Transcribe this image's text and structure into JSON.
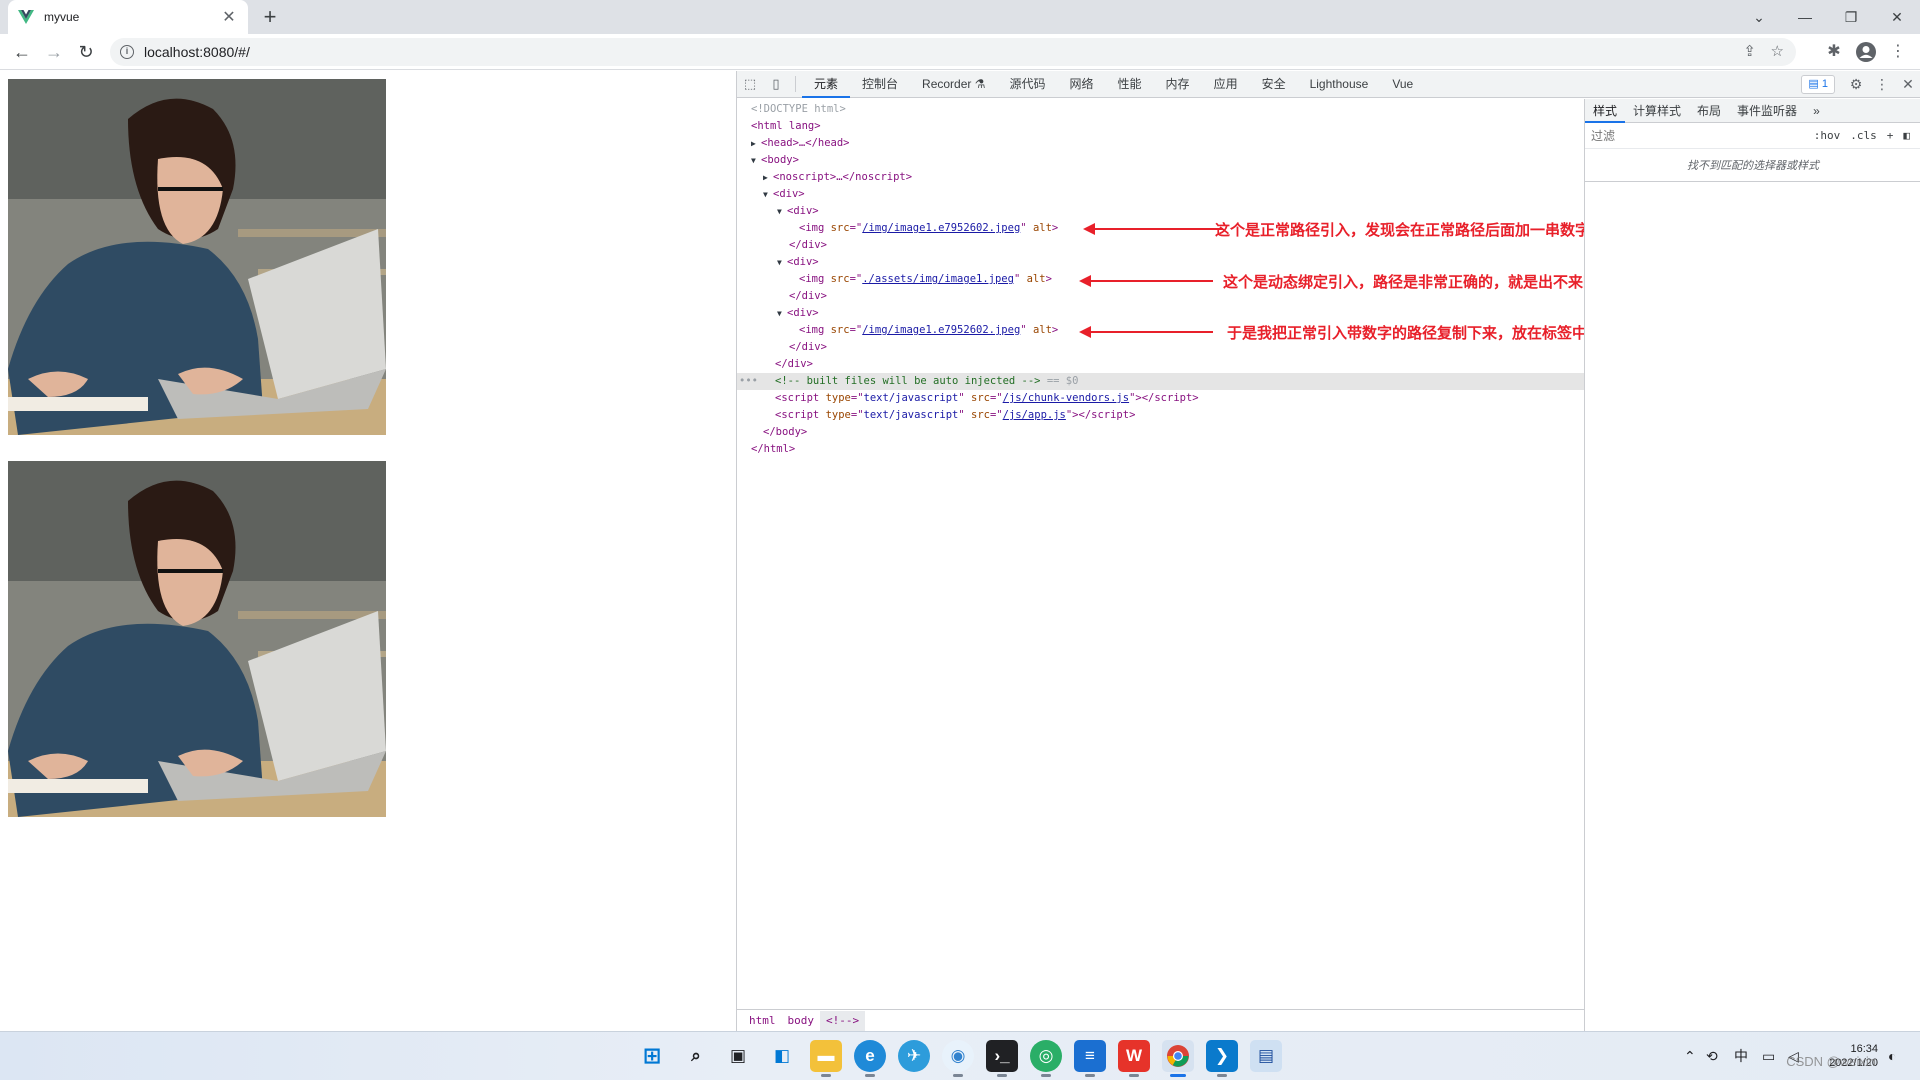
{
  "browser": {
    "tab_title": "myvue",
    "new_tab": "+",
    "url": "localhost:8080/#/"
  },
  "page": {
    "images": [
      {
        "alt": "woman studying with laptop"
      },
      {
        "alt": "woman studying with laptop"
      }
    ]
  },
  "devtools": {
    "tabs": [
      "元素",
      "控制台",
      "Recorder",
      "源代码",
      "网络",
      "性能",
      "内存",
      "应用",
      "安全",
      "Lighthouse",
      "Vue"
    ],
    "active_tab": "元素",
    "issues_count": "1",
    "dom": {
      "doctype": "<!DOCTYPE html>",
      "html_open": "<html lang>",
      "head": "<head>…</head>",
      "body_open": "<body>",
      "noscript": "<noscript>…</noscript>",
      "div_open": "<div>",
      "img_src_1": "/img/image1.e7952602.jpeg",
      "img_src_2": "./assets/img/image1.jpeg",
      "img_src_3": "/img/image1.e7952602.jpeg",
      "div_close": "</div>",
      "comment": "<!-- built files will be auto injected -->",
      "eq_marker": "== $0",
      "script_1_src": "/js/chunk-vendors.js",
      "script_2_src": "/js/app.js",
      "script_type": "text/javascript",
      "body_close": "</body>",
      "html_close": "</html>"
    },
    "annotations": [
      "这个是正常路径引入，发现会在正常路径后面加一串数字",
      "这个是动态绑定引入，路径是非常正确的，就是出不来图片",
      "于是我把正常引入带数字的路径复制下来，放在标签中发现也能出来效果"
    ],
    "breadcrumbs": [
      "html",
      "body",
      "<!-->"
    ],
    "styles": {
      "tabs": [
        "样式",
        "计算样式",
        "布局",
        "事件监听器"
      ],
      "filter_placeholder": "过滤",
      "hov": ":hov",
      "cls": ".cls",
      "no_match": "找不到匹配的选择器或样式"
    }
  },
  "taskbar": {
    "ime": "中",
    "time": "16:34",
    "date": "2022/1/20",
    "watermark": "CSDN @weixin"
  },
  "colors": {
    "annotation": "#e8202a",
    "accent": "#1a73e8"
  }
}
